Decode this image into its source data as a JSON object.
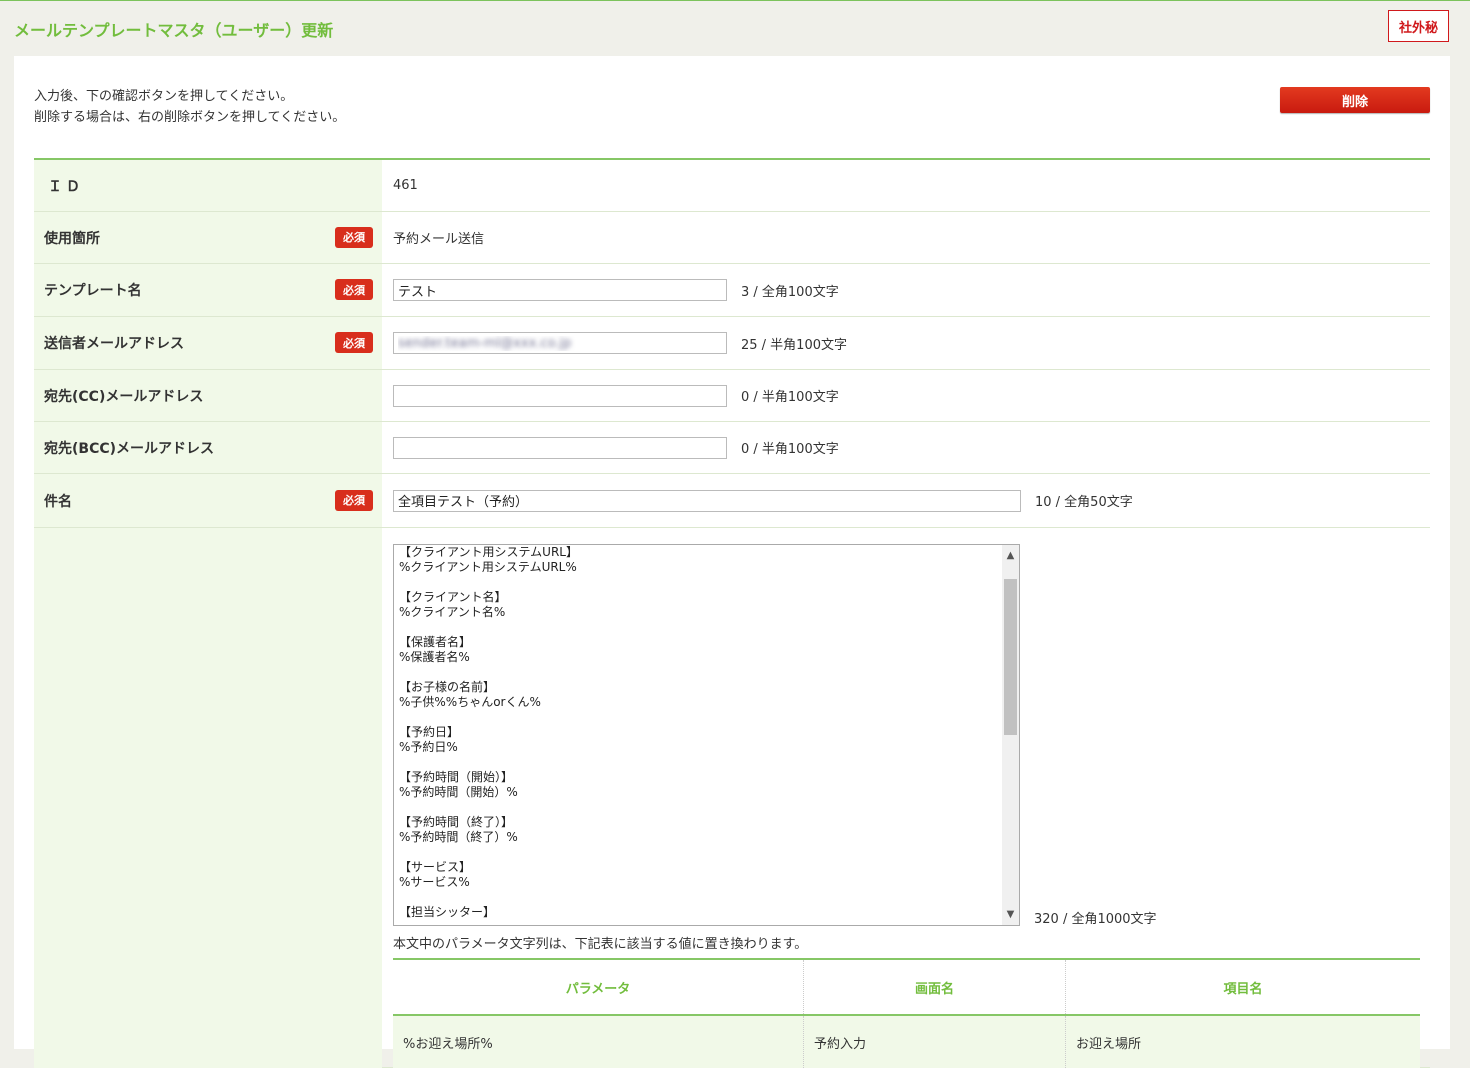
{
  "header": {
    "title": "メールテンプレートマスタ（ユーザー）更新",
    "confidential": "社外秘"
  },
  "instructions": {
    "line1": "入力後、下の確認ボタンを押してください。",
    "line2": "削除する場合は、右の削除ボタンを押してください。"
  },
  "delete_label": "削除",
  "required_label": "必須",
  "fields": {
    "id": {
      "label": "ＩＤ",
      "value": "461"
    },
    "usage": {
      "label": "使用箇所",
      "value": "予約メール送信"
    },
    "template_name": {
      "label": "テンプレート名",
      "value": "テスト",
      "counter": "3 / 全角100文字"
    },
    "sender": {
      "label": "送信者メールアドレス",
      "value": "sender.team-ml@xxx.co.jp",
      "counter": "25 / 半角100文字"
    },
    "cc": {
      "label": "宛先(CC)メールアドレス",
      "value": "",
      "counter": "0 / 半角100文字"
    },
    "bcc": {
      "label": "宛先(BCC)メールアドレス",
      "value": "",
      "counter": "0 / 半角100文字"
    },
    "subject": {
      "label": "件名",
      "value": "全項目テスト（予約）",
      "counter": "10 / 全角50文字"
    }
  },
  "body": {
    "text": "【クライアント用システムURL】\n%クライアント用システムURL%\n\n【クライアント名】\n%クライアント名%\n\n【保護者名】\n%保護者名%\n\n【お子様の名前】\n%子供%%ちゃんorくん%\n\n【予約日】\n%予約日%\n\n【予約時間（開始）】\n%予約時間（開始）%\n\n【予約時間（終了）】\n%予約時間（終了）%\n\n【サービス】\n%サービス%\n\n【担当シッター】",
    "counter": "320 / 全角1000文字",
    "param_note": "本文中のパラメータ文字列は、下記表に該当する値に置き換わります。"
  },
  "param_table": {
    "headers": [
      "パラメータ",
      "画面名",
      "項目名"
    ],
    "rows": [
      [
        "%お迎え場所%",
        "予約入力",
        "お迎え場所"
      ]
    ]
  }
}
